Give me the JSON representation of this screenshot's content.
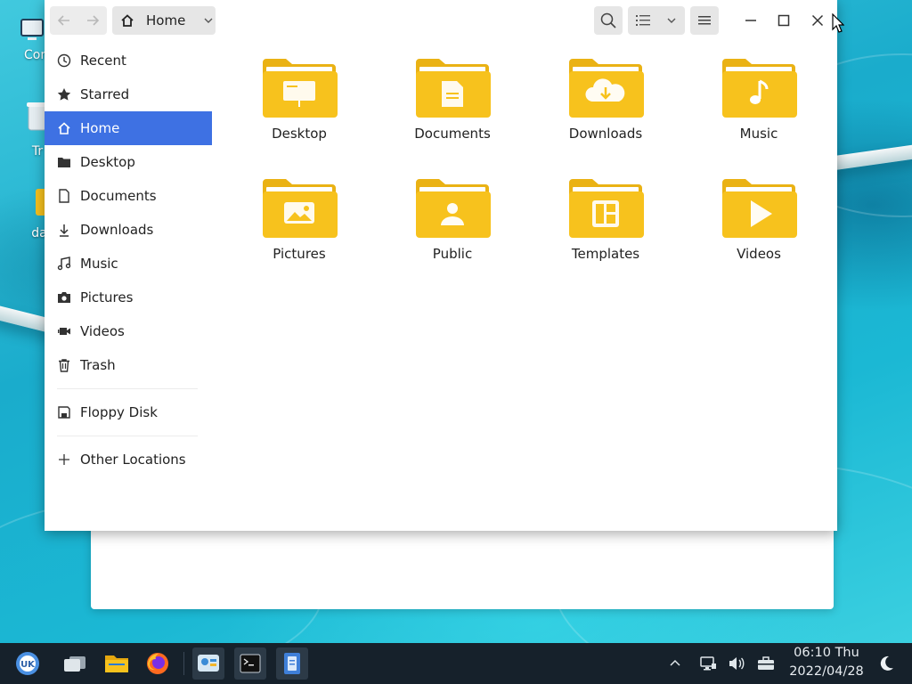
{
  "desktop": {
    "icons": [
      {
        "label": "Com",
        "icon": "computer-icon"
      },
      {
        "label": "Tr",
        "icon": "trash-icon"
      },
      {
        "label": "da",
        "icon": "folder-icon"
      }
    ]
  },
  "window": {
    "location": {
      "label": "Home",
      "icon": "home-icon"
    },
    "sidebar": {
      "items": [
        {
          "label": "Recent",
          "icon": "clock-icon"
        },
        {
          "label": "Starred",
          "icon": "star-icon"
        },
        {
          "label": "Home",
          "icon": "home-icon",
          "active": true
        },
        {
          "label": "Desktop",
          "icon": "folder-icon"
        },
        {
          "label": "Documents",
          "icon": "document-icon"
        },
        {
          "label": "Downloads",
          "icon": "download-icon"
        },
        {
          "label": "Music",
          "icon": "music-icon"
        },
        {
          "label": "Pictures",
          "icon": "camera-icon"
        },
        {
          "label": "Videos",
          "icon": "video-icon"
        },
        {
          "label": "Trash",
          "icon": "trash-icon"
        }
      ],
      "devices": [
        {
          "label": "Floppy Disk",
          "icon": "floppy-icon"
        }
      ],
      "other": {
        "label": "Other Locations",
        "icon": "plus-icon"
      }
    },
    "files": [
      {
        "label": "Desktop",
        "emblem": "presentation"
      },
      {
        "label": "Documents",
        "emblem": "document"
      },
      {
        "label": "Downloads",
        "emblem": "cloud-download"
      },
      {
        "label": "Music",
        "emblem": "music-note"
      },
      {
        "label": "Pictures",
        "emblem": "image"
      },
      {
        "label": "Public",
        "emblem": "person"
      },
      {
        "label": "Templates",
        "emblem": "layout"
      },
      {
        "label": "Videos",
        "emblem": "play"
      }
    ]
  },
  "taskbar": {
    "clock": {
      "time": "06:10 Thu",
      "date": "2022/04/28"
    }
  },
  "colors": {
    "accent": "#3e71e3",
    "folder": "#f7c21d",
    "taskbar": "#16212b"
  }
}
